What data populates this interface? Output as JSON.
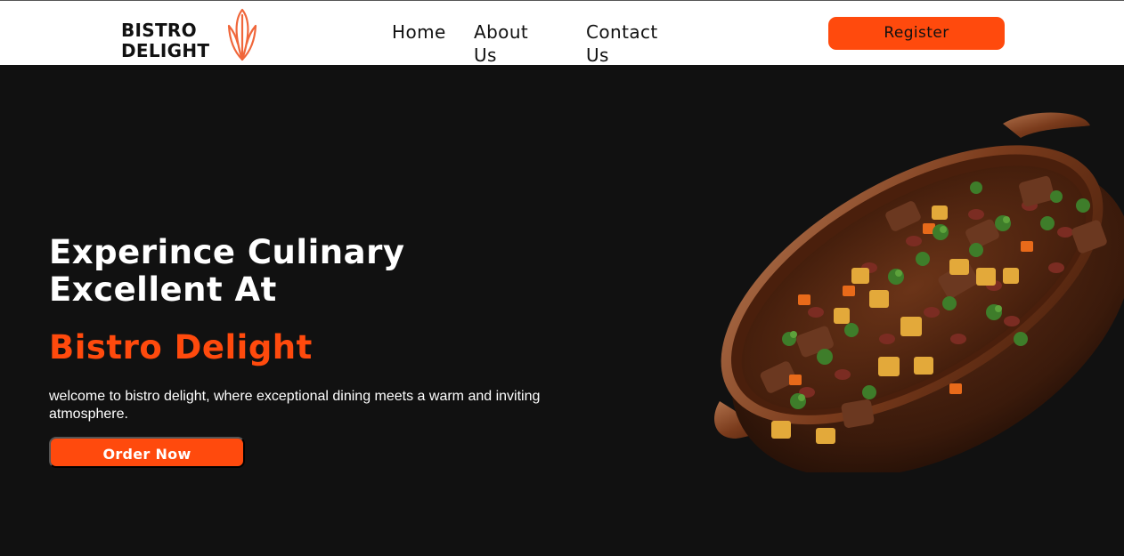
{
  "brand": {
    "logo_line1": "BISTRO",
    "logo_line2": "DELIGHT",
    "logo_icon": "corn-icon",
    "accent_color": "#ff4a0d"
  },
  "nav": {
    "items": [
      {
        "label": "Home"
      },
      {
        "label": "About Us"
      },
      {
        "label": "Contact Us"
      }
    ],
    "register_label": "Register"
  },
  "hero": {
    "headline_line1": "Experince Culinary",
    "headline_line2": "Excellent At",
    "brand_name": "Bistro Delight",
    "tagline": "welcome to bistro delight, where exceptional dining meets a warm and inviting atmosphere.",
    "cta_label": "Order Now",
    "image": "bean-and-beef-stew-bowl"
  }
}
